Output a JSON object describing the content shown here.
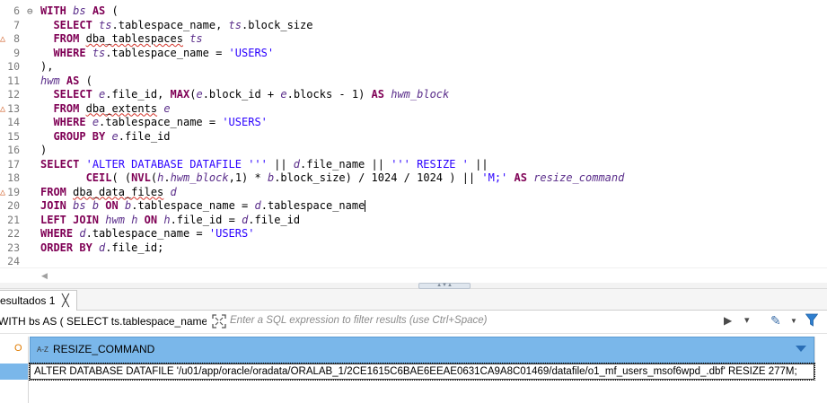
{
  "editor": {
    "lines": [
      {
        "num": "6",
        "fold": "⊖",
        "warn": false,
        "tokens": [
          [
            "kw",
            "WITH"
          ],
          [
            "t",
            " "
          ],
          [
            "al",
            "bs"
          ],
          [
            "t",
            " "
          ],
          [
            "kw",
            "AS"
          ],
          [
            "t",
            " ("
          ]
        ]
      },
      {
        "num": "7",
        "fold": "",
        "warn": false,
        "tokens": [
          [
            "t",
            "  "
          ],
          [
            "kw",
            "SELECT"
          ],
          [
            "t",
            " "
          ],
          [
            "al",
            "ts"
          ],
          [
            "t",
            ".tablespace_name, "
          ],
          [
            "al",
            "ts"
          ],
          [
            "t",
            ".block_size"
          ]
        ]
      },
      {
        "num": "8",
        "fold": "",
        "warn": true,
        "tokens": [
          [
            "t",
            "  "
          ],
          [
            "kw",
            "FROM"
          ],
          [
            "t",
            " "
          ],
          [
            "sq",
            "dba_tablespaces"
          ],
          [
            "t",
            " "
          ],
          [
            "al",
            "ts"
          ]
        ]
      },
      {
        "num": "9",
        "fold": "",
        "warn": false,
        "tokens": [
          [
            "t",
            "  "
          ],
          [
            "kw",
            "WHERE"
          ],
          [
            "t",
            " "
          ],
          [
            "al",
            "ts"
          ],
          [
            "t",
            ".tablespace_name = "
          ],
          [
            "str",
            "'USERS'"
          ]
        ]
      },
      {
        "num": "10",
        "fold": "",
        "warn": false,
        "tokens": [
          [
            "t",
            "),"
          ]
        ]
      },
      {
        "num": "11",
        "fold": "",
        "warn": false,
        "tokens": [
          [
            "al",
            "hwm"
          ],
          [
            "t",
            " "
          ],
          [
            "kw",
            "AS"
          ],
          [
            "t",
            " ("
          ]
        ]
      },
      {
        "num": "12",
        "fold": "",
        "warn": false,
        "tokens": [
          [
            "t",
            "  "
          ],
          [
            "kw",
            "SELECT"
          ],
          [
            "t",
            " "
          ],
          [
            "al",
            "e"
          ],
          [
            "t",
            ".file_id, "
          ],
          [
            "kw",
            "MAX"
          ],
          [
            "t",
            "("
          ],
          [
            "al",
            "e"
          ],
          [
            "t",
            ".block_id + "
          ],
          [
            "al",
            "e"
          ],
          [
            "t",
            ".blocks - 1) "
          ],
          [
            "kw",
            "AS"
          ],
          [
            "t",
            " "
          ],
          [
            "al",
            "hwm_block"
          ]
        ]
      },
      {
        "num": "13",
        "fold": "",
        "warn": true,
        "tokens": [
          [
            "t",
            "  "
          ],
          [
            "kw",
            "FROM"
          ],
          [
            "t",
            " "
          ],
          [
            "sq",
            "dba_extents"
          ],
          [
            "t",
            " "
          ],
          [
            "al",
            "e"
          ]
        ]
      },
      {
        "num": "14",
        "fold": "",
        "warn": false,
        "tokens": [
          [
            "t",
            "  "
          ],
          [
            "kw",
            "WHERE"
          ],
          [
            "t",
            " "
          ],
          [
            "al",
            "e"
          ],
          [
            "t",
            ".tablespace_name = "
          ],
          [
            "str",
            "'USERS'"
          ]
        ]
      },
      {
        "num": "15",
        "fold": "",
        "warn": false,
        "tokens": [
          [
            "t",
            "  "
          ],
          [
            "kw",
            "GROUP BY"
          ],
          [
            "t",
            " "
          ],
          [
            "al",
            "e"
          ],
          [
            "t",
            ".file_id"
          ]
        ]
      },
      {
        "num": "16",
        "fold": "",
        "warn": false,
        "tokens": [
          [
            "t",
            ")"
          ]
        ]
      },
      {
        "num": "17",
        "fold": "",
        "warn": false,
        "tokens": [
          [
            "kw",
            "SELECT"
          ],
          [
            "t",
            " "
          ],
          [
            "str",
            "'ALTER DATABASE DATAFILE '''"
          ],
          [
            "t",
            " || "
          ],
          [
            "al",
            "d"
          ],
          [
            "t",
            ".file_name || "
          ],
          [
            "str",
            "''' RESIZE '"
          ],
          [
            "t",
            " ||"
          ]
        ]
      },
      {
        "num": "18",
        "fold": "",
        "warn": false,
        "tokens": [
          [
            "t",
            "       "
          ],
          [
            "kw",
            "CEIL"
          ],
          [
            "t",
            "( ("
          ],
          [
            "kw",
            "NVL"
          ],
          [
            "t",
            "("
          ],
          [
            "al",
            "h"
          ],
          [
            "t",
            "."
          ],
          [
            "al",
            "hwm_block"
          ],
          [
            "t",
            ",1) * "
          ],
          [
            "al",
            "b"
          ],
          [
            "t",
            ".block_size) / 1024 / 1024 ) || "
          ],
          [
            "str",
            "'M;'"
          ],
          [
            "t",
            " "
          ],
          [
            "kw",
            "AS"
          ],
          [
            "t",
            " "
          ],
          [
            "al",
            "resize_command"
          ]
        ]
      },
      {
        "num": "19",
        "fold": "",
        "warn": true,
        "tokens": [
          [
            "kw",
            "FROM"
          ],
          [
            "t",
            " "
          ],
          [
            "sq",
            "dba_data_files"
          ],
          [
            "t",
            " "
          ],
          [
            "al",
            "d"
          ]
        ]
      },
      {
        "num": "20",
        "fold": "",
        "warn": false,
        "tokens": [
          [
            "kw",
            "JOIN"
          ],
          [
            "t",
            " "
          ],
          [
            "al",
            "bs"
          ],
          [
            "t",
            " "
          ],
          [
            "al",
            "b"
          ],
          [
            "t",
            " "
          ],
          [
            "kw",
            "ON"
          ],
          [
            "t",
            " "
          ],
          [
            "al",
            "b"
          ],
          [
            "t",
            ".tablespace_name = "
          ],
          [
            "al",
            "d"
          ],
          [
            "t",
            ".tablespace_name"
          ],
          [
            "caret",
            ""
          ]
        ]
      },
      {
        "num": "21",
        "fold": "",
        "warn": false,
        "tokens": [
          [
            "kw",
            "LEFT JOIN"
          ],
          [
            "t",
            " "
          ],
          [
            "al",
            "hwm"
          ],
          [
            "t",
            " "
          ],
          [
            "al",
            "h"
          ],
          [
            "t",
            " "
          ],
          [
            "kw",
            "ON"
          ],
          [
            "t",
            " "
          ],
          [
            "al",
            "h"
          ],
          [
            "t",
            ".file_id = "
          ],
          [
            "al",
            "d"
          ],
          [
            "t",
            ".file_id"
          ]
        ]
      },
      {
        "num": "22",
        "fold": "",
        "warn": false,
        "tokens": [
          [
            "kw",
            "WHERE"
          ],
          [
            "t",
            " "
          ],
          [
            "al",
            "d"
          ],
          [
            "t",
            ".tablespace_name = "
          ],
          [
            "str",
            "'USERS'"
          ]
        ]
      },
      {
        "num": "23",
        "fold": "",
        "warn": false,
        "tokens": [
          [
            "kw",
            "ORDER BY"
          ],
          [
            "t",
            " "
          ],
          [
            "al",
            "d"
          ],
          [
            "t",
            ".file_id;"
          ]
        ]
      },
      {
        "num": "24",
        "fold": "",
        "warn": false,
        "tokens": []
      }
    ],
    "warn_glyph": "△",
    "scroll_left_glyph": "◀",
    "splitter_glyph": "▲▼▲"
  },
  "results": {
    "tab_label": "esultados 1",
    "tab_close": "╳",
    "query_preview": "WITH bs AS ( SELECT ts.tablespace_name, t",
    "filter_placeholder": "Enter a SQL expression to filter results (use Ctrl+Space)",
    "run_glyph": "▶",
    "history_glyph": "▾",
    "erase_glyph": "✎",
    "erase_dropdown_glyph": "▼",
    "order_glyph": "O",
    "column": {
      "type_glyph": "A-Z",
      "name": "RESIZE_COMMAND"
    },
    "rows": [
      "ALTER DATABASE DATAFILE '/u01/app/oracle/oradata/ORALAB_1/2CE1615C6BAE6EEAE0631CA9A8C01469/datafile/o1_mf_users_msof6wpd_.dbf' RESIZE 277M;"
    ]
  },
  "colors": {
    "keyword": "#7f0055",
    "string": "#2a00ff",
    "alias": "#5a2d8a",
    "selection": "#7ab7ea",
    "warning": "#d05a22"
  }
}
